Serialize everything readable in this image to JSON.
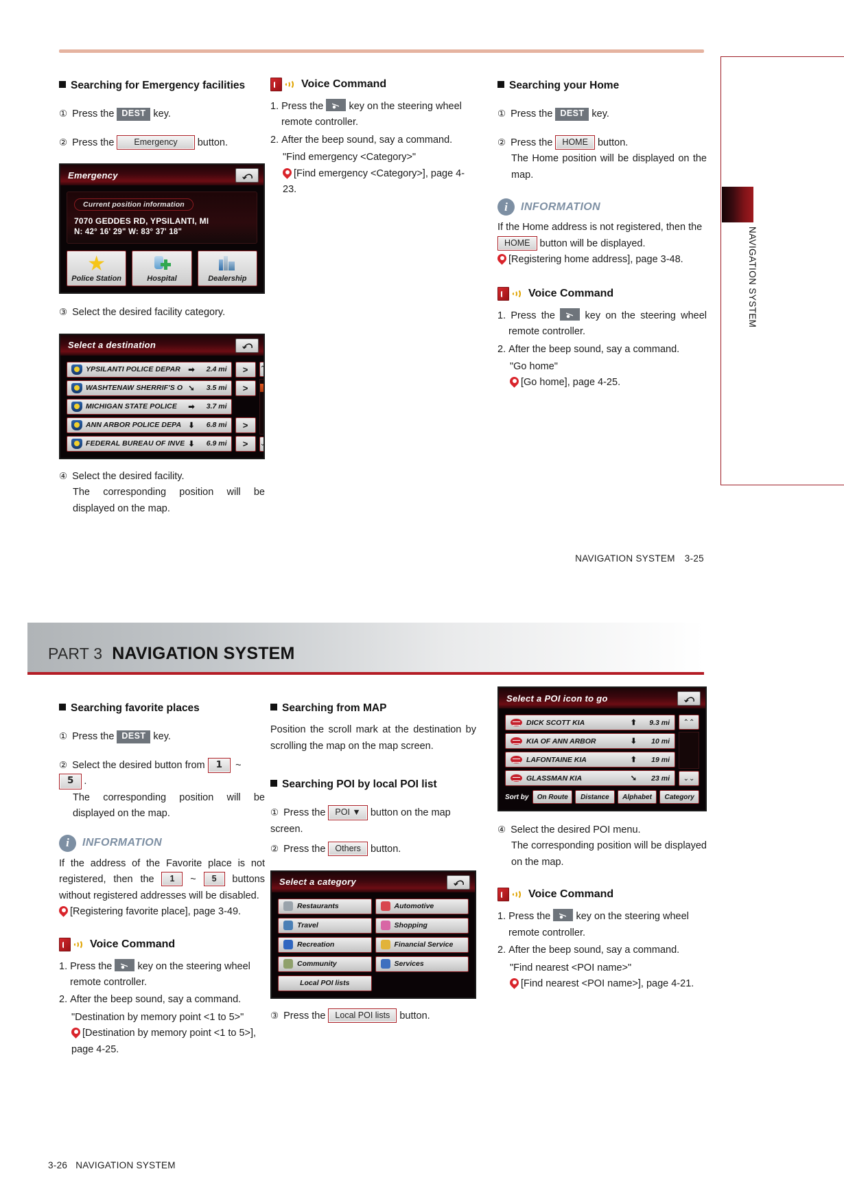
{
  "page1": {
    "footer": {
      "section": "NAVIGATION SYSTEM",
      "page": "3-25"
    },
    "side_tab": {
      "label": "NAVIGATION SYSTEM"
    },
    "col1": {
      "heading": "Searching for Emergency facilities",
      "step1_pre": "Press the",
      "step1_key": "DEST",
      "step1_post": "key.",
      "step2_pre": "Press the",
      "step2_btn": "Emergency",
      "step2_post": "button.",
      "step3": "Select the desired facility category.",
      "step4": "Select the desired facility.",
      "step4_sub": "The corresponding position will be displayed on the map.",
      "emergency_screen": {
        "title": "Emergency",
        "back_icon": "back-arrow-icon",
        "pill": "Current position information",
        "address": "7070 GEDDES RD, YPSILANTI, MI",
        "coords": "N: 42° 16' 29\"    W: 83° 37' 18\"",
        "categories": [
          {
            "label": "Police Station",
            "icon": "star-icon"
          },
          {
            "label": "Hospital",
            "icon": "hospital-icon"
          },
          {
            "label": "Dealership",
            "icon": "dealership-icon"
          }
        ]
      },
      "destination_screen": {
        "title": "Select a destination",
        "back_icon": "back-arrow-icon",
        "rows": [
          {
            "name": "YPSILANTI POLICE DEPAR",
            "arrow": "➡",
            "distance": "2.4 mi",
            "next": ">"
          },
          {
            "name": "WASHTENAW SHERRIF'S O",
            "arrow": "➘",
            "distance": "3.5 mi",
            "next": ">"
          },
          {
            "name": "MICHIGAN STATE POLICE",
            "arrow": "➡",
            "distance": "3.7 mi",
            "next": ""
          },
          {
            "name": "ANN ARBOR POLICE DEPA",
            "arrow": "⬇",
            "distance": "6.8 mi",
            "next": ">"
          },
          {
            "name": "FEDERAL BUREAU OF INVE",
            "arrow": "⬇",
            "distance": "6.9 mi",
            "next": ">"
          }
        ],
        "scroll_up": "⌃⌃",
        "scroll_down": "⌄⌄"
      }
    },
    "col2": {
      "voice_command": {
        "title": "Voice Command",
        "items": [
          "Press the  key on the steering wheel remote controller.",
          "After the beep sound, say a command."
        ],
        "item1_pre": "Press the",
        "item1_post": "key on the steering wheel remote controller.",
        "item2": "After the beep sound, say a command.",
        "quote": "\"Find emergency <Category>\"",
        "ref": "[Find emergency <Category>], page 4-23."
      }
    },
    "col3": {
      "heading": "Searching your Home",
      "step1_pre": "Press the",
      "step1_key": "DEST",
      "step1_post": "key.",
      "step2_pre": "Press the",
      "step2_btn": "HOME",
      "step2_post": "button.",
      "step2_sub": "The Home position will be displayed on the map.",
      "information": {
        "title": "INFORMATION",
        "line1_pre": "If the Home address is not registered, then the",
        "line1_btn": "HOME",
        "line1_post": "button will be displayed.",
        "ref": "[Registering home address], page 3-48."
      },
      "voice_command": {
        "title": "Voice Command",
        "item1_pre": "Press the",
        "item1_post": "key on the steering wheel remote controller.",
        "item2": "After the beep sound, say a command.",
        "quote": "\"Go home\"",
        "ref": "[Go home], page 4-25."
      }
    }
  },
  "page2": {
    "banner": {
      "part": "PART 3",
      "title": "NAVIGATION SYSTEM"
    },
    "footer": {
      "page": "3-26",
      "section": "NAVIGATION SYSTEM"
    },
    "col1": {
      "heading": "Searching favorite places",
      "step1_pre": "Press the",
      "step1_key": "DEST",
      "step1_post": "key.",
      "step2_pre": "Select the desired button from",
      "step2_btn_a": "1",
      "step2_tilde": "~",
      "step2_btn_b": "5",
      "step2_post": ".",
      "step2_sub": "The corresponding position will be displayed on the map.",
      "information": {
        "title": "INFORMATION",
        "line_pre": "If the address of the Favorite place is not registered, then the",
        "btn_a": "1",
        "tilde": "~",
        "btn_b": "5",
        "line_mid": "buttons",
        "line_post": "without registered addresses will be disabled.",
        "ref": "[Registering favorite place], page 3-49."
      },
      "voice_command": {
        "title": "Voice Command",
        "item1_pre": "Press the",
        "item1_post": "key on the steering wheel remote controller.",
        "item2": "After the beep sound, say a command.",
        "quote": "\"Destination by memory point <1 to 5>\"",
        "ref": "[Destination by memory point <1 to 5>], page 4-25."
      }
    },
    "col2": {
      "heading_map": "Searching from MAP",
      "map_text": "Position the scroll mark at the destination by scrolling the map on the map screen.",
      "heading_poi": "Searching POI by local POI list",
      "step1_pre": "Press the",
      "step1_btn": "POI ▼",
      "step1_post": "button on the map screen.",
      "step2_pre": "Press the",
      "step2_btn": "Others",
      "step2_post": "button.",
      "step3_pre": "Press the",
      "step3_btn": "Local POI lists",
      "step3_post": "button.",
      "category_screen": {
        "title": "Select a category",
        "back_icon": "back-arrow-icon",
        "buttons": [
          {
            "label": "Restaurants",
            "icon": "restaurant-icon",
            "color": "#9aa3ab"
          },
          {
            "label": "Automotive",
            "icon": "car-icon",
            "color": "#d8474f"
          },
          {
            "label": "Travel",
            "icon": "travel-icon",
            "color": "#4a7fb5"
          },
          {
            "label": "Shopping",
            "icon": "shopping-icon",
            "color": "#d866a5"
          },
          {
            "label": "Recreation",
            "icon": "recreation-icon",
            "color": "#2f66c0"
          },
          {
            "label": "Financial Service",
            "icon": "bank-icon",
            "color": "#e2b33a"
          },
          {
            "label": "Community",
            "icon": "community-icon",
            "color": "#8fa06b"
          },
          {
            "label": "Services",
            "icon": "services-icon",
            "color": "#3f6fbf"
          }
        ],
        "last_button": {
          "label": "Local POI lists",
          "icon": "list-icon"
        }
      }
    },
    "col3": {
      "poi_screen": {
        "title": "Select a POI icon to go",
        "back_icon": "back-arrow-icon",
        "rows": [
          {
            "name": "DICK SCOTT KIA",
            "arrow": "⬆",
            "distance": "9.3 mi"
          },
          {
            "name": "KIA OF ANN ARBOR",
            "arrow": "⬇",
            "distance": "10 mi"
          },
          {
            "name": "LAFONTAINE KIA",
            "arrow": "⬆",
            "distance": "19 mi"
          },
          {
            "name": "GLASSMAN KIA",
            "arrow": "➘",
            "distance": "23 mi"
          }
        ],
        "scroll_up": "⌃⌃",
        "scroll_down": "⌄⌄",
        "sort_label": "Sort by",
        "sort_buttons": [
          "On Route",
          "Distance",
          "Alphabet",
          "Category"
        ]
      },
      "step4": "Select the desired POI menu.",
      "step4_sub": "The corresponding position will be displayed on the map.",
      "voice_command": {
        "title": "Voice Command",
        "item1_pre": "Press the",
        "item1_post": "key on the steering wheel remote controller.",
        "item2": "After the beep sound, say a command.",
        "quote": "\"Find nearest <POI name>\"",
        "ref": "[Find nearest <POI name>], page 4-21."
      }
    }
  }
}
